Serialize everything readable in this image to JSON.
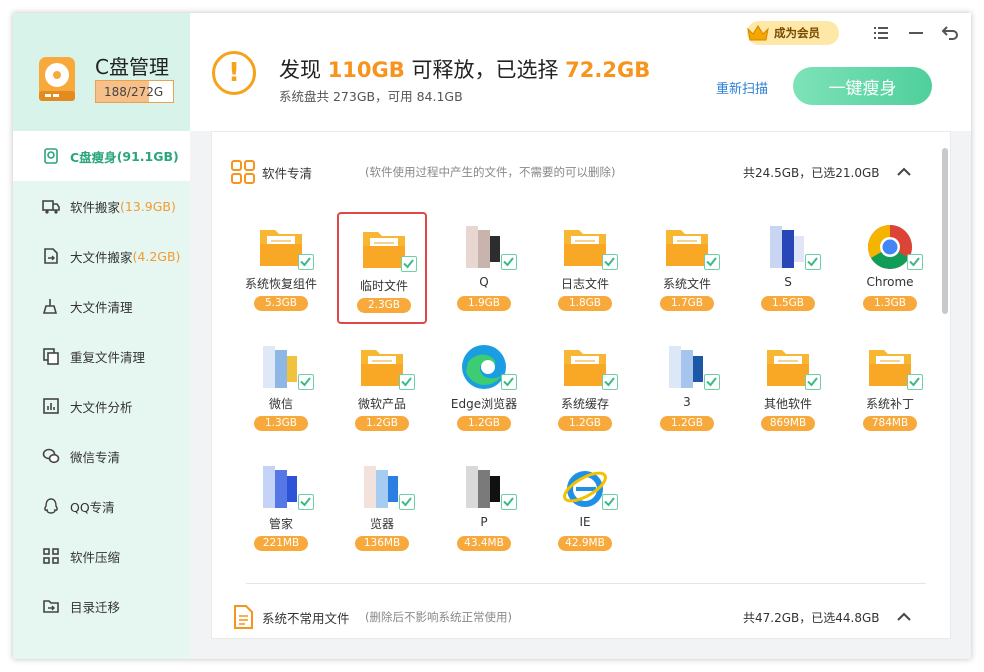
{
  "app": {
    "title": "C盘管理",
    "usage_text": "188/272G",
    "usage_fraction": 0.691
  },
  "header": {
    "title_prefix": "发现 ",
    "free_size": "110GB",
    "title_middle": " 可释放，已选择 ",
    "selected_size": "72.2GB",
    "subtitle": "系统盘共 273GB，可用 84.1GB",
    "rescan_label": "重新扫描",
    "slim_label": "一键瘦身",
    "vip_label": "成为会员"
  },
  "sidebar": {
    "items": [
      {
        "label": "C盘瘦身",
        "count": "(91.1GB)",
        "icon": "disk-slim-icon",
        "active": true
      },
      {
        "label": "软件搬家",
        "count": "(13.9GB)",
        "icon": "truck-icon"
      },
      {
        "label": "大文件搬家",
        "count": "(4.2GB)",
        "icon": "file-move-icon"
      },
      {
        "label": "大文件清理",
        "count": "",
        "icon": "broom-icon"
      },
      {
        "label": "重复文件清理",
        "count": "",
        "icon": "duplicate-icon"
      },
      {
        "label": "大文件分析",
        "count": "",
        "icon": "chart-icon"
      },
      {
        "label": "微信专清",
        "count": "",
        "icon": "wechat-icon"
      },
      {
        "label": "QQ专清",
        "count": "",
        "icon": "qq-icon"
      },
      {
        "label": "软件压缩",
        "count": "",
        "icon": "compress-icon"
      },
      {
        "label": "目录迁移",
        "count": "",
        "icon": "folder-move-icon"
      }
    ]
  },
  "sections": [
    {
      "title": "软件专清",
      "desc": "(软件使用过程中产生的文件，不需要的可以删除)",
      "stat": "共24.5GB，已选21.0GB",
      "icon": "apps-grid-icon"
    },
    {
      "title": "系统不常用文件",
      "desc": "(删除后不影响系统正常使用)",
      "stat": "共47.2GB，已选44.8GB",
      "icon": "document-icon"
    }
  ],
  "tiles": [
    {
      "name": "系统恢复组件",
      "size": "5.3GB",
      "icon": "folder"
    },
    {
      "name": "临时文件",
      "size": "2.3GB",
      "icon": "folder",
      "selected": true
    },
    {
      "name": "Q",
      "size": "1.9GB",
      "icon": "blur-qq"
    },
    {
      "name": "日志文件",
      "size": "1.8GB",
      "icon": "folder"
    },
    {
      "name": "系统文件",
      "size": "1.7GB",
      "icon": "folder"
    },
    {
      "name": "S",
      "size": "1.5GB",
      "icon": "blur-wps"
    },
    {
      "name": "Chrome",
      "size": "1.3GB",
      "icon": "chrome"
    },
    {
      "name": "微信",
      "size": "1.3GB",
      "icon": "blur-wechat"
    },
    {
      "name": "微软产品",
      "size": "1.2GB",
      "icon": "folder"
    },
    {
      "name": "Edge浏览器",
      "size": "1.2GB",
      "icon": "edge"
    },
    {
      "name": "系统缓存",
      "size": "1.2GB",
      "icon": "folder"
    },
    {
      "name": "3",
      "size": "1.2GB",
      "icon": "blur-app"
    },
    {
      "name": "其他软件",
      "size": "869MB",
      "icon": "folder"
    },
    {
      "name": "系统补丁",
      "size": "784MB",
      "icon": "folder"
    },
    {
      "name": "管家",
      "size": "221MB",
      "icon": "blur-guard"
    },
    {
      "name": "览器",
      "size": "136MB",
      "icon": "blur-browser"
    },
    {
      "name": "P",
      "size": "43.4MB",
      "icon": "blur-dark"
    },
    {
      "name": "IE",
      "size": "42.9MB",
      "icon": "ie"
    }
  ],
  "colors": {
    "accent": "#2aa67a",
    "orange": "#f7941d",
    "badge": "#f7a93b",
    "blue_link": "#2b7fd6"
  }
}
